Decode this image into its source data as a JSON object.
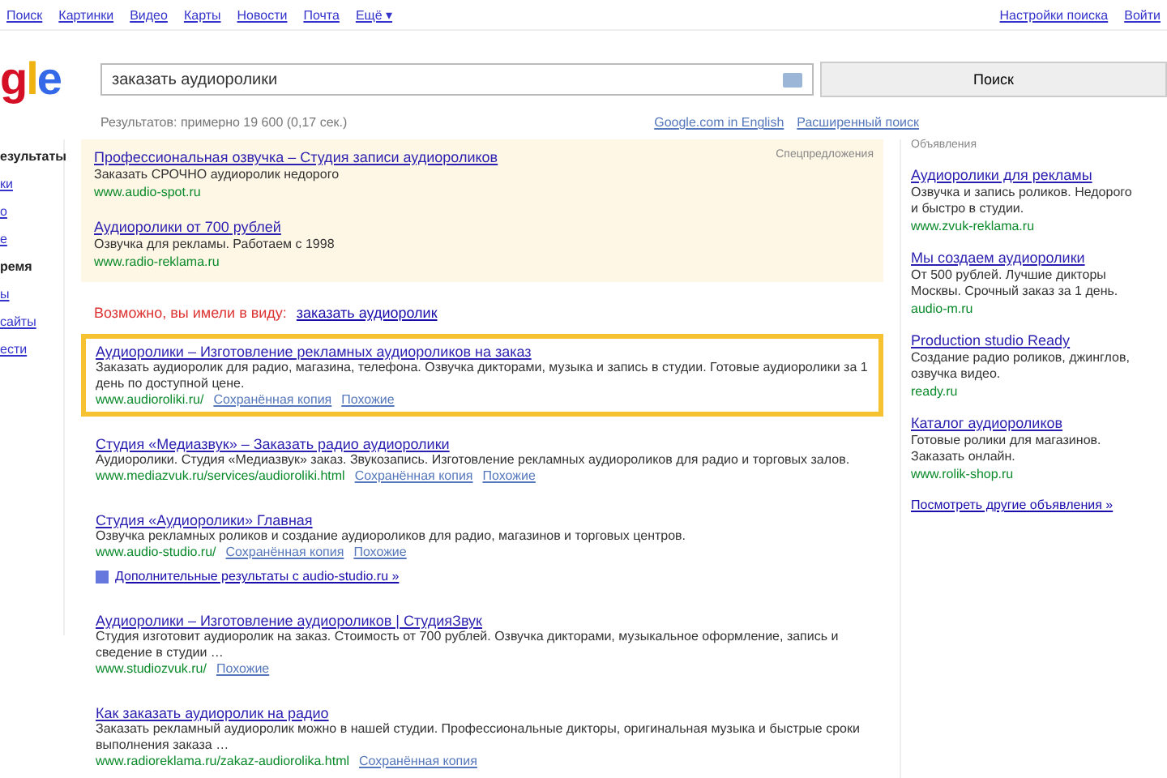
{
  "top_nav": {
    "links": [
      "Поиск",
      "Картинки",
      "Видео",
      "Карты",
      "Новости",
      "Почта",
      "Ещё ▾"
    ],
    "right_links": [
      "Настройки поиска",
      "Войти"
    ]
  },
  "logo": "gle",
  "search": {
    "value": "заказать аудиоролики",
    "button": "Поиск",
    "stats": "Результатов: примерно 19 600 (0,17 сек.)",
    "links": [
      "Google.com in English",
      "Расширенный поиск"
    ]
  },
  "sidebar": {
    "items": [
      {
        "label": "езультаты",
        "selected": true
      },
      {
        "label": "ки",
        "selected": false
      },
      {
        "label": "о",
        "selected": false
      },
      {
        "label": "е",
        "selected": false
      },
      {
        "label": "ремя",
        "selected": true
      },
      {
        "label": "ы",
        "selected": false
      },
      {
        "label": "сайты",
        "selected": false
      },
      {
        "label": "ести",
        "selected": false
      }
    ]
  },
  "top_ads": {
    "label": "Спецпредложения",
    "items": [
      {
        "title": "Профессиональная озвучка – Студия записи аудиороликов",
        "snippet": "Заказать СРОЧНО аудиоролик недорого",
        "url": "www.audio-spot.ru"
      },
      {
        "title": "Аудиоролики от 700 рублей",
        "snippet": "Озвучка для рекламы. Работаем с 1998",
        "url": "www.radio-reklama.ru"
      }
    ]
  },
  "did_you_mean": {
    "prefix": "Возможно, вы имели в виду:",
    "suggestion": "заказать аудиоролик"
  },
  "results": [
    {
      "title": "Аудиоролики – Изготовление рекламных аудиороликов на заказ",
      "snippet": "Заказать аудиоролик для радио, магазина, телефона. Озвучка дикторами, музыка и запись в студии. Готовые аудиоролики за 1 день по доступной цене.",
      "url": "www.audioroliki.ru/",
      "cache": "Сохранённая копия",
      "similar": "Похожие",
      "highlighted": true
    },
    {
      "title": "Студия «Медиазвук» – Заказать радио аудиоролики",
      "snippet": "Аудиоролики. Студия «Медиазвук» заказ. Звукозапись. Изготовление рекламных аудиороликов для радио и торговых залов.",
      "url": "www.mediazvuk.ru/services/audioroliki.html",
      "cache": "Сохранённая копия",
      "similar": "Похожие",
      "highlighted": false
    },
    {
      "title": "Студия «Аудиоролики» Главная",
      "snippet": "Озвучка рекламных роликов и создание аудиороликов для радио, магазинов и торговых центров.",
      "url": "www.audio-studio.ru/",
      "cache": "Сохранённая копия",
      "similar": "Похожие",
      "highlighted": false,
      "more": "Дополнительные результаты с audio-studio.ru »"
    },
    {
      "title": "Аудиоролики – Изготовление аудиороликов | СтудияЗвук",
      "snippet": "Студия изготовит аудиоролик на заказ. Стоимость от 700 рублей. Озвучка дикторами, музыкальное оформление, запись и сведение в студии …",
      "url": "www.studiozvuk.ru/",
      "cache": "Похожие",
      "highlighted": false
    },
    {
      "title": "Как заказать аудиоролик на радио",
      "snippet": "Заказать рекламный аудиоролик можно в нашей студии. Профессиональные дикторы, оригинальная музыка и быстрые сроки выполнения заказа …",
      "url": "www.radioreklama.ru/zakaz-audiorolika.html",
      "cache": "Сохранённая копия",
      "highlighted": false
    }
  ],
  "right_ads": {
    "heading": "Объявления",
    "items": [
      {
        "title": "Аудиоролики для рекламы",
        "snippet": "Озвучка и запись роликов. Недорого и быстро в студии.",
        "url": "www.zvuk-reklama.ru"
      },
      {
        "title": "Мы создаем аудиоролики",
        "snippet": "От 500 рублей. Лучшие дикторы Москвы. Срочный заказ за 1 день.",
        "url": "audio-m.ru"
      },
      {
        "title": "Production studio Ready",
        "snippet": "Создание радио роликов, джинглов, озвучка видео.",
        "url": "ready.ru"
      },
      {
        "title": "Каталог аудиороликов",
        "snippet": "Готовые ролики для магазинов. Заказать онлайн.",
        "url": "www.rolik-shop.ru"
      }
    ],
    "more": "Посмотреть другие объявления »"
  }
}
